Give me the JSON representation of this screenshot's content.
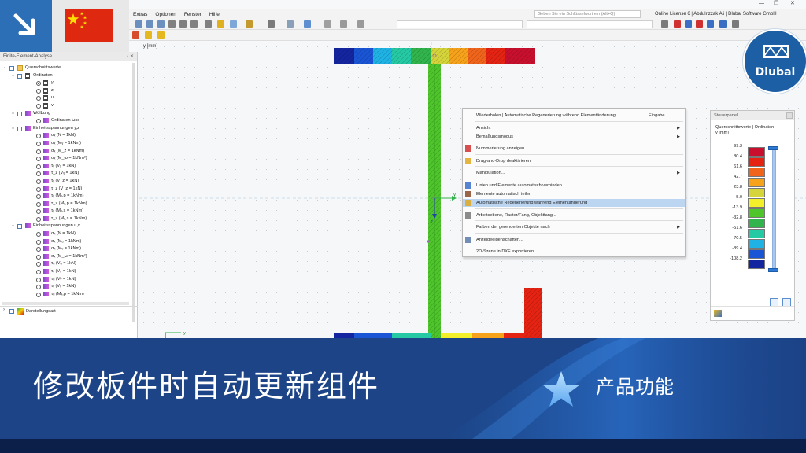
{
  "menu": {
    "items": [
      "Extras",
      "Optionen",
      "Fenster",
      "Hilfe"
    ],
    "search_placeholder": "Geben Sie ein Schlüsselwort ein (Alt+Q)",
    "license": "Online License 6 | Abdulrizzak Ali | Dlubal Software GmbH"
  },
  "left_panel": {
    "title": "Finite-Element-Analyse",
    "tree": [
      {
        "level": 0,
        "exp": "v",
        "check": true,
        "icon": "folder-icon",
        "label": "Querschnittswerte"
      },
      {
        "level": 1,
        "exp": "v",
        "check": true,
        "icon": "ibeam-icon",
        "label": "Ordinaten"
      },
      {
        "level": 2,
        "radio": true,
        "selected": true,
        "icon": "ibeam-icon",
        "label": "y"
      },
      {
        "level": 2,
        "radio": true,
        "icon": "ibeam-icon",
        "label": "z"
      },
      {
        "level": 2,
        "radio": true,
        "icon": "ibeam-icon",
        "label": "u"
      },
      {
        "level": 2,
        "radio": true,
        "icon": "ibeam-icon",
        "label": "v"
      },
      {
        "level": 1,
        "exp": "v",
        "check": true,
        "icon": "warp-icon",
        "label": "Wölbung"
      },
      {
        "level": 2,
        "radio": true,
        "icon": "warp-icon",
        "label": "Ordinaten ωsc"
      },
      {
        "level": 1,
        "exp": "v",
        "check": true,
        "icon": "stress-icon",
        "label": "Einheitsspannungen y,z"
      },
      {
        "level": 2,
        "radio": true,
        "icon": "stress-icon",
        "label": "σₓ (N = 1kN)"
      },
      {
        "level": 2,
        "radio": true,
        "icon": "stress-icon",
        "label": "σₓ (Mᵧ = 1kNm)"
      },
      {
        "level": 2,
        "radio": true,
        "icon": "stress-icon",
        "label": "σₓ (M_z = 1kNm)"
      },
      {
        "level": 2,
        "radio": true,
        "icon": "stress-icon",
        "label": "σₓ (M_ω = 1kNm²)"
      },
      {
        "level": 2,
        "radio": true,
        "icon": "stress-icon",
        "label": "τᵧ (Vᵧ = 1kN)"
      },
      {
        "level": 2,
        "radio": true,
        "icon": "stress-icon",
        "label": "τ_z (Vᵧ = 1kN)"
      },
      {
        "level": 2,
        "radio": true,
        "icon": "stress-icon",
        "label": "τᵧ (V_z = 1kN)"
      },
      {
        "level": 2,
        "radio": true,
        "icon": "stress-icon",
        "label": "τ_z (V_z = 1kN)"
      },
      {
        "level": 2,
        "radio": true,
        "icon": "stress-icon",
        "label": "τᵧ (Mₓ,p = 1kNm)"
      },
      {
        "level": 2,
        "radio": true,
        "icon": "stress-icon",
        "label": "τ_z (Mₓ,p = 1kNm)"
      },
      {
        "level": 2,
        "radio": true,
        "icon": "stress-icon",
        "label": "τᵧ (Mₓ,s = 1kNm)"
      },
      {
        "level": 2,
        "radio": true,
        "icon": "stress-icon",
        "label": "τ_z (Mₓ,s = 1kNm)"
      },
      {
        "level": 1,
        "exp": "v",
        "check": true,
        "icon": "stress-icon",
        "label": "Einheitsspannungen u,v"
      },
      {
        "level": 2,
        "radio": true,
        "icon": "stress-icon",
        "label": "σₓ (N = 1kN)"
      },
      {
        "level": 2,
        "radio": true,
        "icon": "stress-icon",
        "label": "σₓ (Mᵤ = 1kNm)"
      },
      {
        "level": 2,
        "radio": true,
        "icon": "stress-icon",
        "label": "σₓ (Mᵥ = 1kNm)"
      },
      {
        "level": 2,
        "radio": true,
        "icon": "stress-icon",
        "label": "σₓ (M_ω = 1kNm²)"
      },
      {
        "level": 2,
        "radio": true,
        "icon": "stress-icon",
        "label": "τᵤ (Vᵤ = 1kN)"
      },
      {
        "level": 2,
        "radio": true,
        "icon": "stress-icon",
        "label": "τᵥ (Vᵤ = 1kN)"
      },
      {
        "level": 2,
        "radio": true,
        "icon": "stress-icon",
        "label": "τᵤ (Vᵥ = 1kN)"
      },
      {
        "level": 2,
        "radio": true,
        "icon": "stress-icon",
        "label": "τᵥ (Vᵥ = 1kN)"
      },
      {
        "level": 2,
        "radio": true,
        "icon": "stress-icon",
        "label": "τᵤ (Mₓ,p = 1kNm)"
      }
    ],
    "bottom_item": "Darstellungsart"
  },
  "canvas": {
    "axis_label": "y [mm]"
  },
  "context_menu": {
    "items": [
      {
        "label": "Wiederholen | Automatische Regenerierung während Elementänderung",
        "shortcut": "Eingabe"
      },
      {
        "label": "Ansicht",
        "submenu": "▶"
      },
      {
        "label": "Bemaßungsmodus",
        "submenu": "▶"
      },
      {
        "label": "Nummerierung anzeigen",
        "icon": "numbering-icon"
      },
      {
        "label": "Drag-and-Drop deaktivieren",
        "icon": "drag-drop-icon"
      },
      {
        "label": "Manipulation...",
        "submenu": "▶"
      },
      {
        "label": "Linien und Elemente automatisch verbinden",
        "icon": "connect-icon"
      },
      {
        "label": "Elemente automatisch teilen",
        "icon": "split-icon"
      },
      {
        "label": "Automatische Regenerierung während Elementänderung",
        "icon": "regenerate-icon",
        "highlighted": true
      },
      {
        "label": "Arbeitsebene, Raster/Fang, Objektfang...",
        "icon": "grid-icon"
      },
      {
        "label": "Farben der gerenderten Objekte nach",
        "submenu": "▶"
      },
      {
        "label": "Anzeigeeigenschaften...",
        "icon": "display-props-icon"
      },
      {
        "label": "2D-Szene in DXF exportieren..."
      }
    ]
  },
  "control_panel": {
    "title": "Steuerpanel",
    "heading_line1": "Querschnittswerte | Ordinaten",
    "heading_line2": "y [mm]",
    "legend": [
      {
        "value": "99.3",
        "color": "#c8102e"
      },
      {
        "value": "80.4",
        "color": "#e42313"
      },
      {
        "value": "61.6",
        "color": "#f0651b"
      },
      {
        "value": "42.7",
        "color": "#f6a21b"
      },
      {
        "value": "23.8",
        "color": "#d5d43a"
      },
      {
        "value": "5.0",
        "color": "#f4ef2b"
      },
      {
        "value": "-13.9",
        "color": "#4ec52a"
      },
      {
        "value": "-32.8",
        "color": "#31b44b"
      },
      {
        "value": "-51.6",
        "color": "#25c9a3"
      },
      {
        "value": "-70.5",
        "color": "#1fb2e4"
      },
      {
        "value": "-89.4",
        "color": "#1a55d6"
      },
      {
        "value": "-108.2",
        "color": "#1425a0"
      }
    ]
  },
  "badge": {
    "word": "Dlubal"
  },
  "banner": {
    "title": "修改板件时自动更新组件",
    "tag": "产品功能",
    "color": "#1c4486"
  }
}
